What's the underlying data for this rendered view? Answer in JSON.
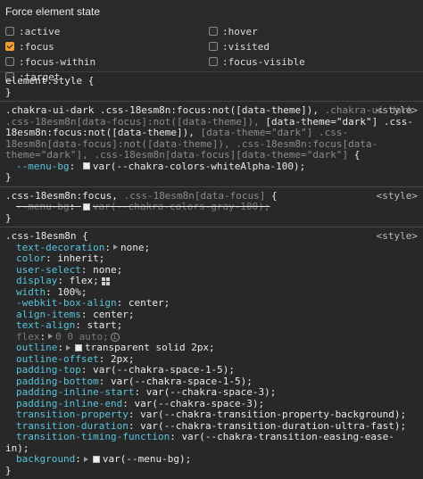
{
  "force_state": {
    "title": "Force element state",
    "states": [
      {
        "label": ":active",
        "checked": false
      },
      {
        "label": ":hover",
        "checked": false
      },
      {
        "label": ":focus",
        "checked": true
      },
      {
        "label": ":visited",
        "checked": false
      },
      {
        "label": ":focus-within",
        "checked": false
      },
      {
        "label": ":focus-visible",
        "checked": false
      },
      {
        "label": ":target",
        "checked": false
      }
    ]
  },
  "rules": {
    "element_style": {
      "selector": "element.style {",
      "close": "}"
    },
    "rule1": {
      "source": "<style>",
      "sel_a": ".chakra-ui-dark .css-18esm8n:focus:not([data-theme]), ",
      "sel_b": ".chakra-ui-dark .css-18esm8n[data-focus]:not([data-theme]), ",
      "sel_c": "[data-theme=\"dark\"] .css-18esm8n:focus:not([data-theme]), ",
      "sel_d": "[data-theme=\"dark\"] .css-18esm8n[data-focus]:not([data-theme]), ",
      "sel_e": ".css-18esm8n:focus[data-theme=\"dark\"], ",
      "sel_f": ".css-18esm8n[data-focus][data-theme=\"dark\"]",
      "open": " {",
      "prop": "--menu-bg",
      "val": "var(--chakra-colors-whiteAlpha-100);",
      "close": "}"
    },
    "rule2": {
      "source": "<style>",
      "sel_a": ".css-18esm8n:focus, ",
      "sel_b": ".css-18esm8n[data-focus]",
      "open": " {",
      "prop": "--menu-bg",
      "val": "var(--chakra-colors-gray-100);",
      "close": "}"
    },
    "rule3": {
      "source": "<style>",
      "selector": ".css-18esm8n {",
      "decls": [
        {
          "prop": "text-decoration",
          "val": "none;"
        },
        {
          "prop": "color",
          "val": "inherit;"
        },
        {
          "prop": "user-select",
          "val": "none;"
        },
        {
          "prop": "display",
          "val": "flex;"
        },
        {
          "prop": "width",
          "val": "100%;"
        },
        {
          "prop": "-webkit-box-align",
          "val": "center;"
        },
        {
          "prop": "align-items",
          "val": "center;"
        },
        {
          "prop": "text-align",
          "val": "start;"
        },
        {
          "prop": "flex",
          "val": "0 0 auto;"
        },
        {
          "prop": "outline",
          "val": "transparent solid 2px;"
        },
        {
          "prop": "outline-offset",
          "val": "2px;"
        },
        {
          "prop": "padding-top",
          "val": "var(--chakra-space-1-5);"
        },
        {
          "prop": "padding-bottom",
          "val": "var(--chakra-space-1-5);"
        },
        {
          "prop": "padding-inline-start",
          "val": "var(--chakra-space-3);"
        },
        {
          "prop": "padding-inline-end",
          "val": "var(--chakra-space-3);"
        },
        {
          "prop": "transition-property",
          "val": "var(--chakra-transition-property-background);"
        },
        {
          "prop": "transition-duration",
          "val": "var(--chakra-transition-duration-ultra-fast);"
        },
        {
          "prop": "transition-timing-function",
          "val": "var(--chakra-transition-easing-ease-in);"
        },
        {
          "prop": "background",
          "val": "var(--menu-bg);"
        }
      ],
      "close": "}"
    }
  }
}
